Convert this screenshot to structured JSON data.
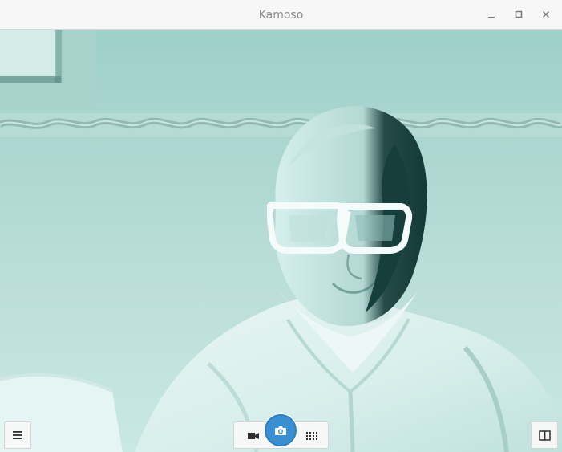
{
  "window": {
    "title": "Kamoso"
  },
  "controls": {
    "minimize": "minimize-icon",
    "maximize": "maximize-icon",
    "close": "close-icon",
    "menu": "hamburger-icon",
    "video": "video-camera-icon",
    "capture": "camera-icon",
    "burst": "grid-icon",
    "split": "split-view-icon"
  },
  "colors": {
    "accent": "#3a8fd2",
    "titlebar": "#f7f7f7",
    "preview_tint": "#b8ddd8"
  }
}
